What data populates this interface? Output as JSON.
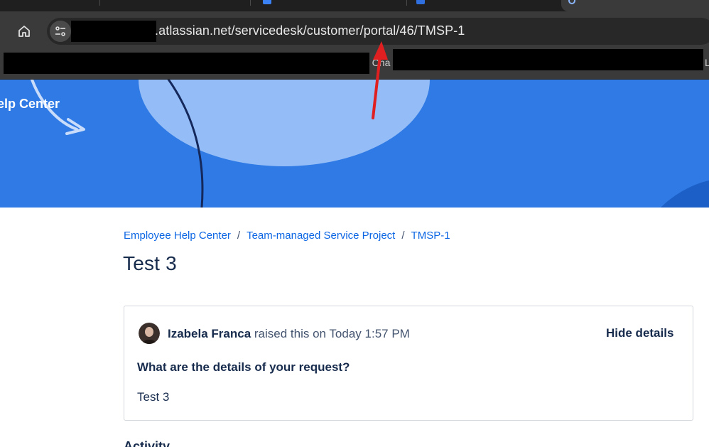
{
  "browser": {
    "address_bar": {
      "url_text": ".atlassian.net/servicedesk/customer/portal/46/TMSP-1"
    },
    "bookmarks": {
      "fragment_left": "‹",
      "fragment_middle": "n Cha",
      "fragment_right": "L"
    }
  },
  "banner": {
    "title": "elp Center",
    "color": "#2f7ae5"
  },
  "breadcrumb": {
    "items": [
      "Employee Help Center",
      "Team-managed Service Project",
      "TMSP-1"
    ],
    "separator": "/"
  },
  "page": {
    "title": "Test 3"
  },
  "request": {
    "reporter": "Izabela Franca",
    "raised_text": " raised this on Today 1:57 PM",
    "hide_details_label": "Hide details",
    "field_label": "What are the details of your request?",
    "field_value": "Test 3"
  },
  "activity": {
    "heading": "Activity"
  },
  "colors": {
    "link": "#0c66e4",
    "text_primary": "#172b4d",
    "annotation_arrow": "#e02020"
  }
}
